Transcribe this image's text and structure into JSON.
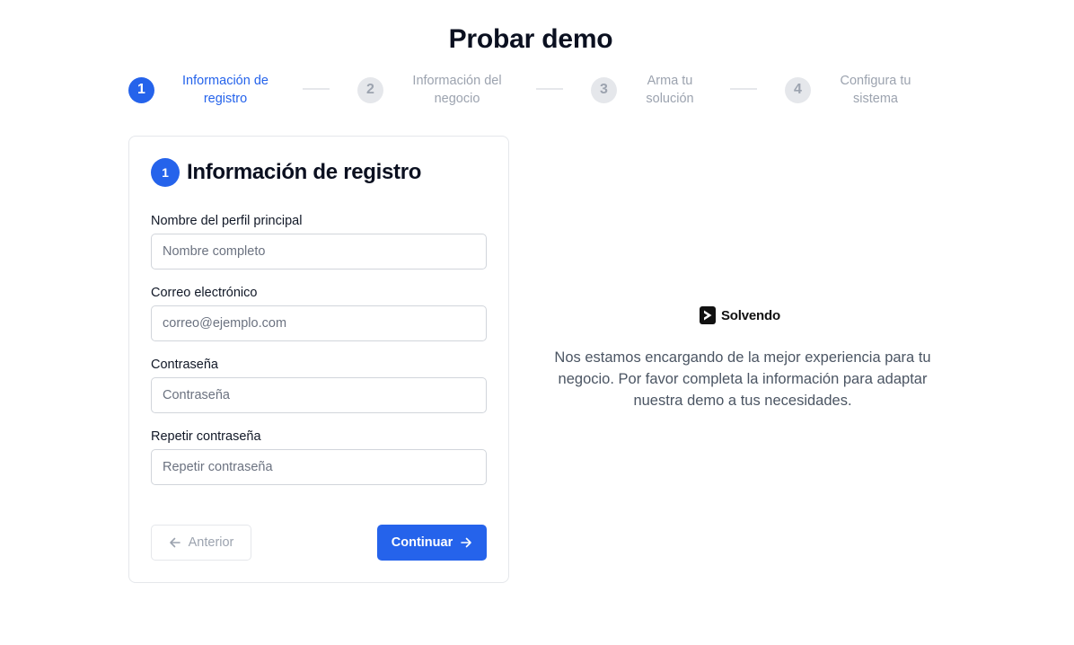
{
  "page": {
    "title": "Probar demo"
  },
  "stepper": {
    "steps": [
      {
        "number": "1",
        "label_line1": "Información de",
        "label_line2": "registro",
        "active": true
      },
      {
        "number": "2",
        "label_line1": "Información del",
        "label_line2": "negocio",
        "active": false
      },
      {
        "number": "3",
        "label_line1": "Arma tu",
        "label_line2": "solución",
        "active": false
      },
      {
        "number": "4",
        "label_line1": "Configura tu",
        "label_line2": "sistema",
        "active": false
      }
    ]
  },
  "form": {
    "step_number": "1",
    "title": "Información de registro",
    "fields": [
      {
        "label": "Nombre del perfil principal",
        "placeholder": "Nombre completo",
        "value": ""
      },
      {
        "label": "Correo electrónico",
        "placeholder": "correo@ejemplo.com",
        "value": ""
      },
      {
        "label": "Contraseña",
        "placeholder": "Contraseña",
        "value": ""
      },
      {
        "label": "Repetir contraseña",
        "placeholder": "Repetir contraseña",
        "value": ""
      }
    ],
    "prev_label": "Anterior",
    "next_label": "Continuar"
  },
  "panel": {
    "brand_name": "Solvendo",
    "message": "Nos estamos encargando de la mejor experiencia para tu negocio. Por favor completa la información para adaptar nuestra demo a tus necesidades."
  },
  "icons": {
    "prev": "arrow-left-icon",
    "next": "arrow-right-icon",
    "brand": "solvendo-logo-icon"
  },
  "colors": {
    "accent": "#2563eb",
    "inactive": "#9ca3af",
    "inactive_bg": "#e5e7eb",
    "text": "#0b1020",
    "muted": "#4b5563"
  }
}
